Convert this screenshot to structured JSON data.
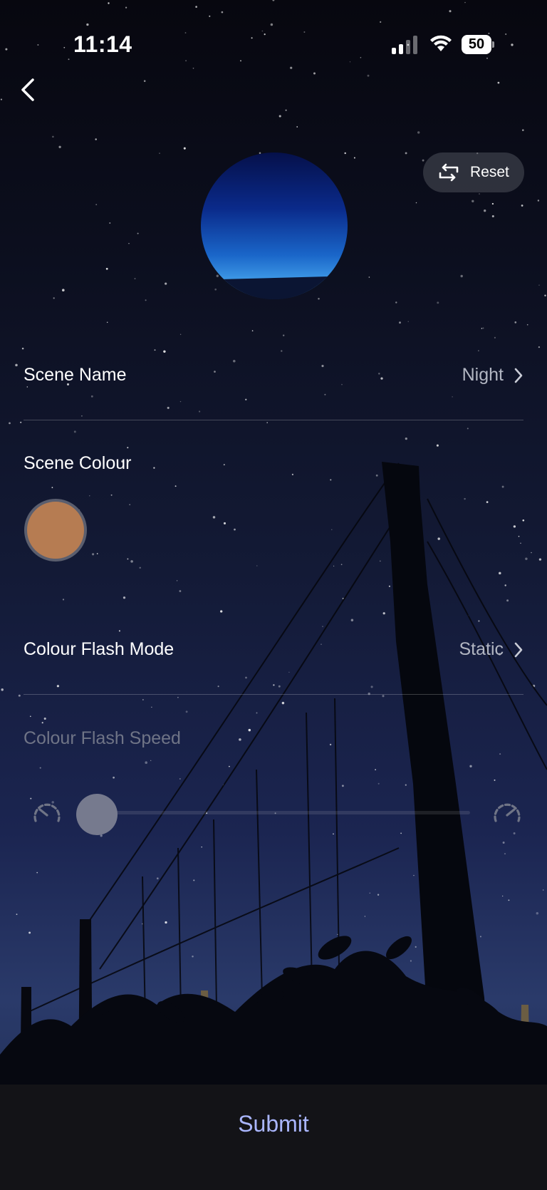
{
  "status_bar": {
    "time": "11:14",
    "battery_level": "50",
    "icons": [
      "signal-icon",
      "wifi-icon",
      "battery-icon"
    ]
  },
  "nav": {
    "back_icon": "chevron-left-icon",
    "reset_label": "Reset",
    "reset_icon": "reset-icon"
  },
  "scene": {
    "preview_icon": "night-scene-preview",
    "name_label": "Scene Name",
    "name_value": "Night",
    "colour_label": "Scene Colour",
    "colour_hex": "#b67c52",
    "flash_mode_label": "Colour Flash Mode",
    "flash_mode_value": "Static",
    "flash_speed_label": "Colour Flash Speed",
    "flash_speed_value": 0,
    "flash_speed_enabled": false
  },
  "footer": {
    "submit_label": "Submit",
    "submit_color": "#aab6ff"
  }
}
